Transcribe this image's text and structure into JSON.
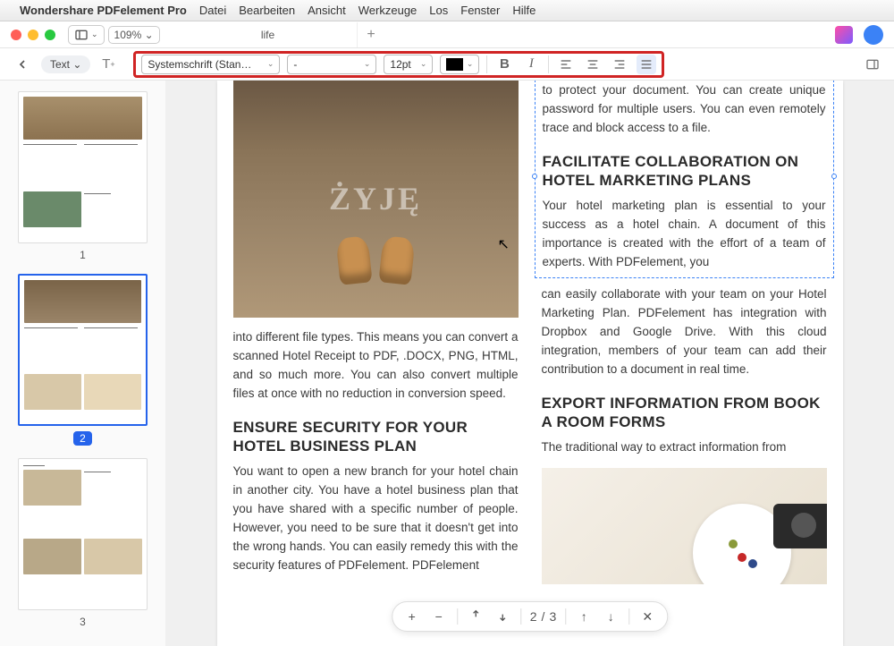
{
  "menubar": {
    "app": "Wondershare PDFelement Pro",
    "items": [
      "Datei",
      "Bearbeiten",
      "Ansicht",
      "Werkzeuge",
      "Los",
      "Fenster",
      "Hilfe"
    ]
  },
  "titlebar": {
    "zoom": "109% ⌄",
    "tab": "life",
    "plus": "+"
  },
  "subtoolbar": {
    "mode": "Text ⌄"
  },
  "format": {
    "font": "Systemschrift (Stan…",
    "weight": "-",
    "size": "12pt"
  },
  "thumbs": {
    "p1": "1",
    "p2": "2",
    "p3": "3"
  },
  "doc": {
    "hero_word": "ŻYJĘ",
    "col1_p1": "into different file types. This means you can convert a scanned Hotel Receipt to PDF, .DOCX, PNG, HTML, and so much more. You can also convert multiple files at once with no reduction in conversion speed.",
    "col1_h1": "ENSURE SECURITY FOR YOUR HOTEL BUSINESS PLAN",
    "col1_p2": "You want to open a new branch for your hotel chain in another city. You have a hotel business plan that you have shared with a specific number of people. However, you need to be sure that it doesn't get into the wrong hands. You can easily remedy this with the security features of PDFelement. PDFelement",
    "col2_p0": "to protect your document. You can create unique password for multiple users. You can even remotely trace and block access to a file.",
    "col2_h1": "FACILITATE COLLABORATION ON HOTEL MARKETING PLANS",
    "col2_p1": "Your hotel marketing plan is essential to your success as a hotel chain. A document of this importance is created with the effort of a team of experts. With PDFelement, you",
    "col2_p1b": "can easily collaborate with your team on your Hotel Marketing Plan. PDFelement has integration with Dropbox and Google Drive. With this cloud integration, members of your team can add their contribution to a document in real time.",
    "col2_h2": "EXPORT INFORMATION FROM BOOK A ROOM FORMS",
    "col2_p2": "The traditional way to extract information from"
  },
  "pagectl": {
    "num": "2",
    "total": "3"
  }
}
